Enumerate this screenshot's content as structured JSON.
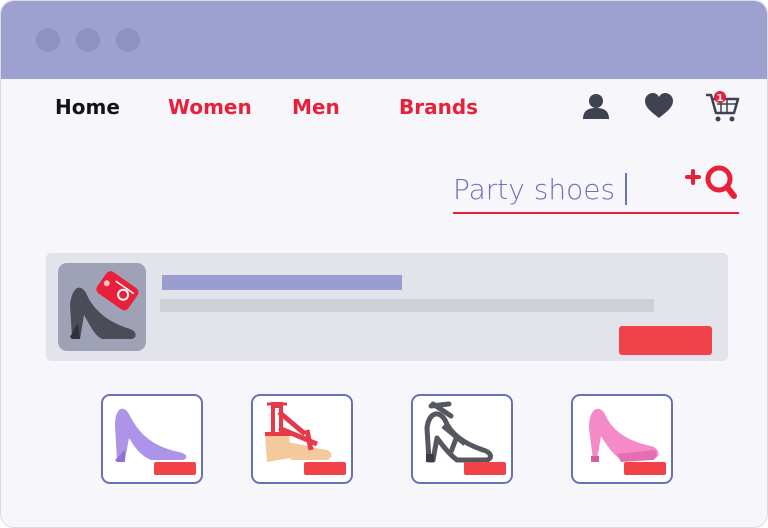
{
  "nav": {
    "items": [
      {
        "label": "Home",
        "active": true
      },
      {
        "label": "Women",
        "active": false
      },
      {
        "label": "Men",
        "active": false
      },
      {
        "label": "Brands",
        "active": false
      }
    ]
  },
  "header_icons": [
    "user-icon",
    "heart-icon",
    "cart-icon"
  ],
  "cart": {
    "count": "1"
  },
  "search": {
    "value": "Party shoes"
  },
  "promo": {
    "thumbnail": "high-heel-with-sale-tag"
  },
  "products": [
    {
      "icon": "purple-pump-icon",
      "color": "#ad94e8"
    },
    {
      "icon": "wedge-sandal-icon",
      "color": "#e8394a"
    },
    {
      "icon": "strappy-heel-icon",
      "color": "#55585f"
    },
    {
      "icon": "pink-platform-heel-icon",
      "color": "#f48bc8"
    }
  ],
  "colors": {
    "titlebar": "#9ea1cf",
    "accent": "#e8203a",
    "button": "#f1424a",
    "search_text": "#6d72b8",
    "card_border": "#6a70b5"
  }
}
